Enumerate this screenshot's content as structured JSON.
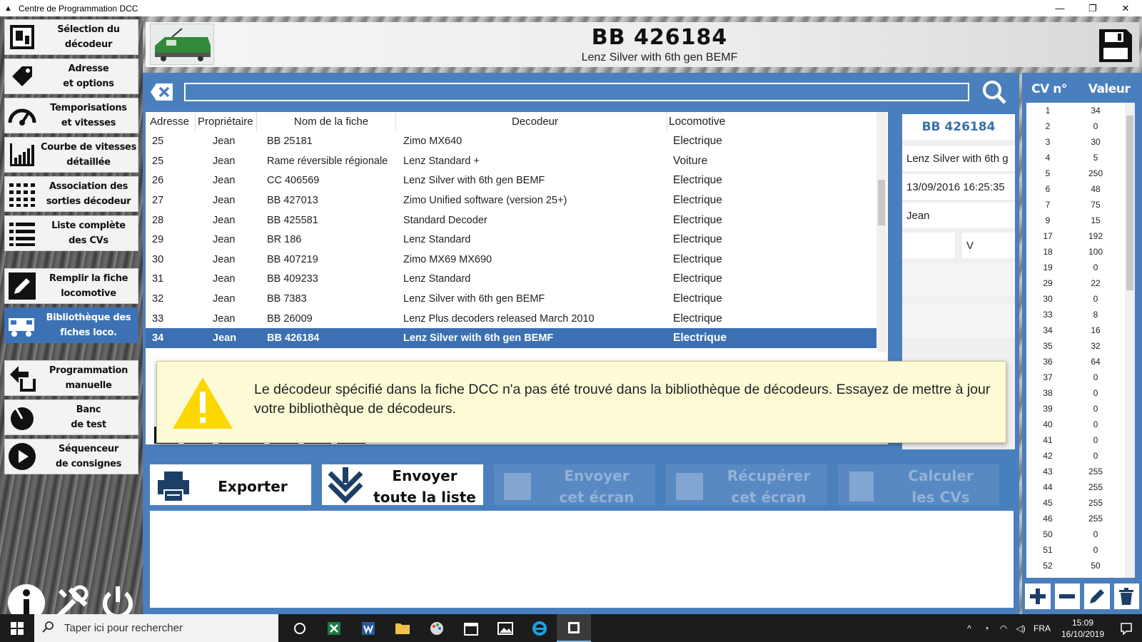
{
  "window": {
    "title": "Centre de Programmation DCC",
    "controls": [
      "minimize-icon",
      "maximize-icon",
      "close-icon"
    ]
  },
  "sidebar": {
    "items": [
      {
        "label": "Sélection du\ndécodeur",
        "icon": "decoder-chip-icon",
        "active": false
      },
      {
        "label": "Adresse\net options",
        "icon": "tag-icon",
        "active": false
      },
      {
        "label": "Temporisations\net vitesses",
        "icon": "speedometer-icon",
        "active": false
      },
      {
        "label": "Courbe de vitesses\ndétaillée",
        "icon": "bar-chart-icon",
        "active": false
      },
      {
        "label": "Association des\nsorties décodeur",
        "icon": "grid-dots-icon",
        "active": false
      },
      {
        "label": "Liste complète\ndes CVs",
        "icon": "list-icon",
        "active": false
      },
      {
        "label": "Remplir la fiche\nlocomotive",
        "icon": "pencil-icon",
        "active": false
      },
      {
        "label": "Bibliothèque des\nfiches loco.",
        "icon": "locomotive-icon",
        "active": true
      },
      {
        "label": "Programmation\nmanuelle",
        "icon": "download-arrow-icon",
        "active": false
      },
      {
        "label": "Banc\nde test",
        "icon": "dial-icon",
        "active": false
      },
      {
        "label": "Séquenceur\nde consignes",
        "icon": "play-icon",
        "active": false
      }
    ],
    "bottom": [
      "info-icon",
      "tools-icon",
      "power-icon"
    ]
  },
  "header": {
    "title": "BB 426184",
    "subtitle": "Lenz Silver with 6th gen BEMF"
  },
  "search": {
    "value": "",
    "placeholder": ""
  },
  "table": {
    "columns": [
      "Adresse",
      "Propriétaire",
      "Nom de la fiche",
      "Decodeur",
      "Locomotive"
    ],
    "rows": [
      [
        "25",
        "Jean",
        "BB 25181",
        "Zimo MX640",
        "Electrique"
      ],
      [
        "25",
        "Jean",
        "Rame réversible régionale",
        "Lenz Standard +",
        "Voiture"
      ],
      [
        "26",
        "Jean",
        "CC 406569",
        "Lenz Silver with 6th gen BEMF",
        "Electrique"
      ],
      [
        "27",
        "Jean",
        "BB 427013",
        "Zimo Unified software (version 25+)",
        "Electrique"
      ],
      [
        "28",
        "Jean",
        "BB 425581",
        "Standard Decoder",
        "Electrique"
      ],
      [
        "29",
        "Jean",
        "BR 186",
        "Lenz Standard",
        "Electrique"
      ],
      [
        "30",
        "Jean",
        "BB 407219",
        "Zimo MX69 MX690",
        "Electrique"
      ],
      [
        "31",
        "Jean",
        "BB 409233",
        "Lenz Standard",
        "Electrique"
      ],
      [
        "32",
        "Jean",
        "BB 7383",
        "Lenz Silver with 6th gen BEMF",
        "Electrique"
      ],
      [
        "33",
        "Jean",
        "BB 26009",
        "Lenz Plus decoders released March 2010",
        "Electrique"
      ],
      [
        "34",
        "Jean",
        "BB 426184",
        "Lenz Silver with 6th gen BEMF",
        "Electrique"
      ]
    ],
    "selected_index": 10
  },
  "detail": {
    "name": "BB 426184",
    "decoder": "Lenz Silver with 6th g",
    "date": "13/09/2016 16:25:35",
    "owner": "Jean",
    "voltage_unit": "V"
  },
  "alert": {
    "message": "Le décodeur spécifié dans la fiche DCC n'a pas été trouvé dans la bibliothèque de décodeurs. Essayez de mettre à jour votre bibliothèque de décodeurs."
  },
  "actions": [
    {
      "label": "Exporter",
      "icon": "printer-icon",
      "enabled": true
    },
    {
      "label": "Envoyer\ntoute la liste",
      "icon": "double-chevron-down-icon",
      "enabled": true
    },
    {
      "label": "Envoyer\ncet écran",
      "icon": "send-icon",
      "enabled": false
    },
    {
      "label": "Récupérer\ncet écran",
      "icon": "receive-icon",
      "enabled": false
    },
    {
      "label": "Calculer\nles CVs",
      "icon": "calculator-icon",
      "enabled": false
    }
  ],
  "cv": {
    "header_num": "CV n°",
    "header_val": "Valeur",
    "rows": [
      [
        "1",
        "34"
      ],
      [
        "2",
        "0"
      ],
      [
        "3",
        "30"
      ],
      [
        "4",
        "5"
      ],
      [
        "5",
        "250"
      ],
      [
        "6",
        "48"
      ],
      [
        "7",
        "75"
      ],
      [
        "9",
        "15"
      ],
      [
        "17",
        "192"
      ],
      [
        "18",
        "100"
      ],
      [
        "19",
        "0"
      ],
      [
        "29",
        "22"
      ],
      [
        "30",
        "0"
      ],
      [
        "33",
        "8"
      ],
      [
        "34",
        "16"
      ],
      [
        "35",
        "32"
      ],
      [
        "36",
        "64"
      ],
      [
        "37",
        "0"
      ],
      [
        "38",
        "0"
      ],
      [
        "39",
        "0"
      ],
      [
        "40",
        "0"
      ],
      [
        "41",
        "0"
      ],
      [
        "42",
        "0"
      ],
      [
        "43",
        "255"
      ],
      [
        "44",
        "255"
      ],
      [
        "45",
        "255"
      ],
      [
        "46",
        "255"
      ],
      [
        "50",
        "0"
      ],
      [
        "51",
        "0"
      ],
      [
        "52",
        "50"
      ]
    ],
    "tools": [
      "plus-icon",
      "minus-icon",
      "edit-pencil-icon",
      "trash-icon"
    ]
  },
  "taskbar": {
    "search_placeholder": "Taper ici pour rechercher",
    "language": "FRA",
    "time": "15:09",
    "date": "16/10/2019"
  },
  "colors": {
    "accent_blue": "#4a7fbd",
    "selected_row": "#3b70b2",
    "alert_bg": "#fdfbd6",
    "warning_yellow": "#ffd700"
  }
}
